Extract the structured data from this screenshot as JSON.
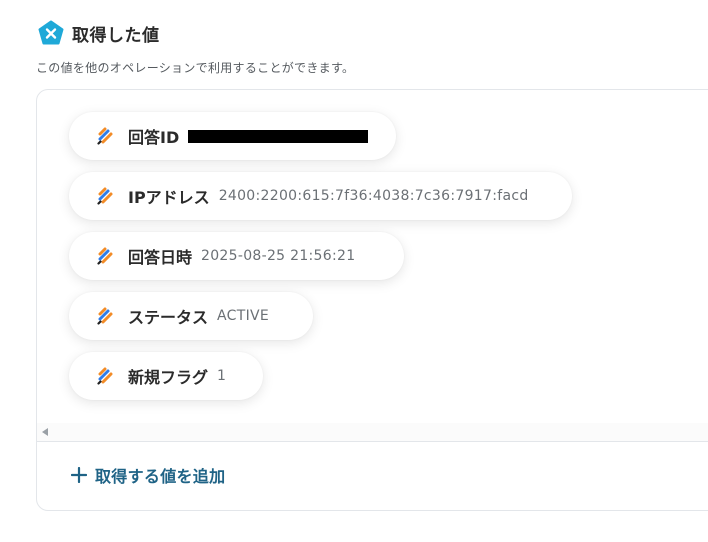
{
  "header": {
    "title": "取得した値",
    "icon": "yoom-pentagon-icon",
    "icon_color": "#1fa9d8"
  },
  "description": "この値を他のオペレーションで利用することができます。",
  "values": [
    {
      "label": "回答ID",
      "value": "",
      "redacted": true
    },
    {
      "label": "IPアドレス",
      "value": "2400:2200:615:7f36:4038:7c36:7917:facd",
      "redacted": false
    },
    {
      "label": "回答日時",
      "value": "2025-08-25 21:56:21",
      "redacted": false
    },
    {
      "label": "ステータス",
      "value": "ACTIVE",
      "redacted": false
    },
    {
      "label": "新規フラグ",
      "value": "1",
      "redacted": false
    }
  ],
  "add_button": {
    "label": "取得する値を追加",
    "icon": "plus-icon"
  },
  "colors": {
    "accent": "#1f6386",
    "border": "#e3e6ea",
    "icon_orange": "#f28c28",
    "icon_blue": "#2f7dea"
  }
}
